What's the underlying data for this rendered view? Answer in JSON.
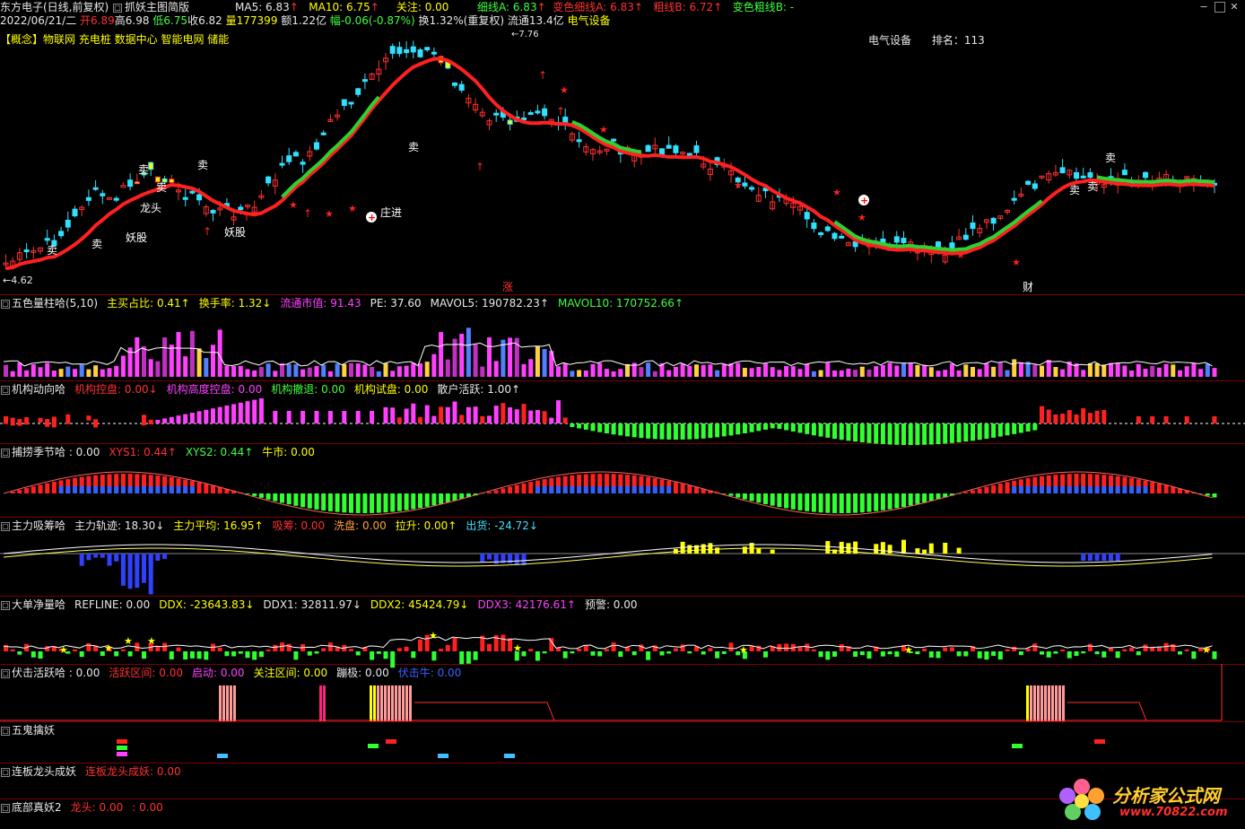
{
  "title_bar": {
    "stock": "东方电子(日线,前复权)",
    "indicator": "抓妖主图简版",
    "ma5": "MA5: 6.83",
    "ma10": "MA10: 6.75",
    "focus": "关注: 0.00",
    "thin_a": "细线A: 6.83",
    "thin_a_color": "变色细线A: 6.83",
    "thick_b": "粗线B: 6.72",
    "thick_b_color": "变色粗线B: -"
  },
  "quote_bar": {
    "date": "2022/06/21/二",
    "open": "开6.89",
    "high": "高6.98",
    "low": "低6.75",
    "close": "收6.82",
    "volume": "量177399",
    "amount": "额1.22亿",
    "change": "幅-0.06(-0.87%)",
    "turnover": "换1.32%(重复权)",
    "float": "流通13.4亿",
    "sector": "电气设备"
  },
  "concept_bar": {
    "label": "【概念】",
    "concepts": "物联网 充电桩 数据中心 智能电网 储能",
    "industry": "电气设备",
    "rank": "排名：113"
  },
  "main_chart": {
    "price_low_label": "←4.62",
    "price_high_label": "←7.76",
    "annotations": {
      "sell": "卖",
      "demon": "妖股",
      "bank_enter": "庄进",
      "rise": "涨",
      "wealth": "财",
      "dragon": "龙头"
    },
    "colors": {
      "ma_red": "#ff2020",
      "ma_green": "#30d030",
      "candle_up": "#ff3030",
      "candle_down": "#30e0ff"
    }
  },
  "panels": [
    {
      "id": "volume",
      "title": "五色量柱哈(5,10)",
      "items": [
        {
          "t": "主买占比: 0.41↑",
          "c": "yellow"
        },
        {
          "t": "换手率: 1.32↓",
          "c": "yellow"
        },
        {
          "t": "流通市值: 91.43",
          "c": "mag"
        },
        {
          "t": "PE: 37.60",
          "c": "white"
        },
        {
          "t": "MAVOL5: 190782.23↑",
          "c": "white"
        },
        {
          "t": "MAVOL10: 170752.66↑",
          "c": "green"
        }
      ]
    },
    {
      "id": "inst",
      "title": "机构动向哈",
      "items": [
        {
          "t": "机构控盘: 0.00↓",
          "c": "red"
        },
        {
          "t": "机构高度控盘: 0.00",
          "c": "mag"
        },
        {
          "t": "机构撤退: 0.00",
          "c": "green"
        },
        {
          "t": "机构试盘: 0.00",
          "c": "yellow"
        },
        {
          "t": "散户活跃: 1.00↑",
          "c": "white"
        }
      ]
    },
    {
      "id": "season",
      "title": "捕捞季节哈 : 0.00",
      "items": [
        {
          "t": "XYS1: 0.44↑",
          "c": "red"
        },
        {
          "t": "XYS2: 0.44↑",
          "c": "green"
        },
        {
          "t": "牛市: 0.00",
          "c": "yellow"
        }
      ]
    },
    {
      "id": "absorb",
      "title": "主力吸筹哈",
      "items": [
        {
          "t": "主力轨迹: 18.30↓",
          "c": "white"
        },
        {
          "t": "主力平均: 16.95↑",
          "c": "yellow"
        },
        {
          "t": "吸筹: 0.00",
          "c": "red"
        },
        {
          "t": "洗盘: 0.00",
          "c": "orange"
        },
        {
          "t": "拉升: 0.00↑",
          "c": "yellow"
        },
        {
          "t": "出货: -24.72↓",
          "c": "cyan"
        }
      ]
    },
    {
      "id": "ddx",
      "title": "大单净量哈",
      "items": [
        {
          "t": "REFLINE: 0.00",
          "c": "white"
        },
        {
          "t": "DDX: -23643.83↓",
          "c": "yellow"
        },
        {
          "t": "DDX1: 32811.97↓",
          "c": "white"
        },
        {
          "t": "DDX2: 45424.79↓",
          "c": "yellow"
        },
        {
          "t": "DDX3: 42176.61↑",
          "c": "mag"
        },
        {
          "t": "预警: 0.00",
          "c": "white"
        }
      ]
    },
    {
      "id": "ambush",
      "title": "伏击活跃哈 : 0.00",
      "items": [
        {
          "t": "活跃区间: 0.00",
          "c": "red"
        },
        {
          "t": "启动: 0.00",
          "c": "mag"
        },
        {
          "t": "关注区间: 0.00",
          "c": "yellow"
        },
        {
          "t": "蹦极: 0.00",
          "c": "white"
        },
        {
          "t": "伏击牛: 0.00",
          "c": "blue"
        }
      ]
    },
    {
      "id": "fiveghost",
      "title": "五鬼擒妖",
      "items": []
    },
    {
      "id": "consecutive",
      "title": "连板龙头成妖",
      "items": [
        {
          "t": "连板龙头成妖: 0.00",
          "c": "red"
        }
      ]
    },
    {
      "id": "bottom",
      "title": "底部真妖2",
      "items": [
        {
          "t": "龙头: 0.00",
          "c": "red"
        },
        {
          "t": ": 0.00",
          "c": "red"
        }
      ]
    }
  ],
  "watermark": {
    "name": "分析家公式网",
    "url": "www.70822.com"
  }
}
